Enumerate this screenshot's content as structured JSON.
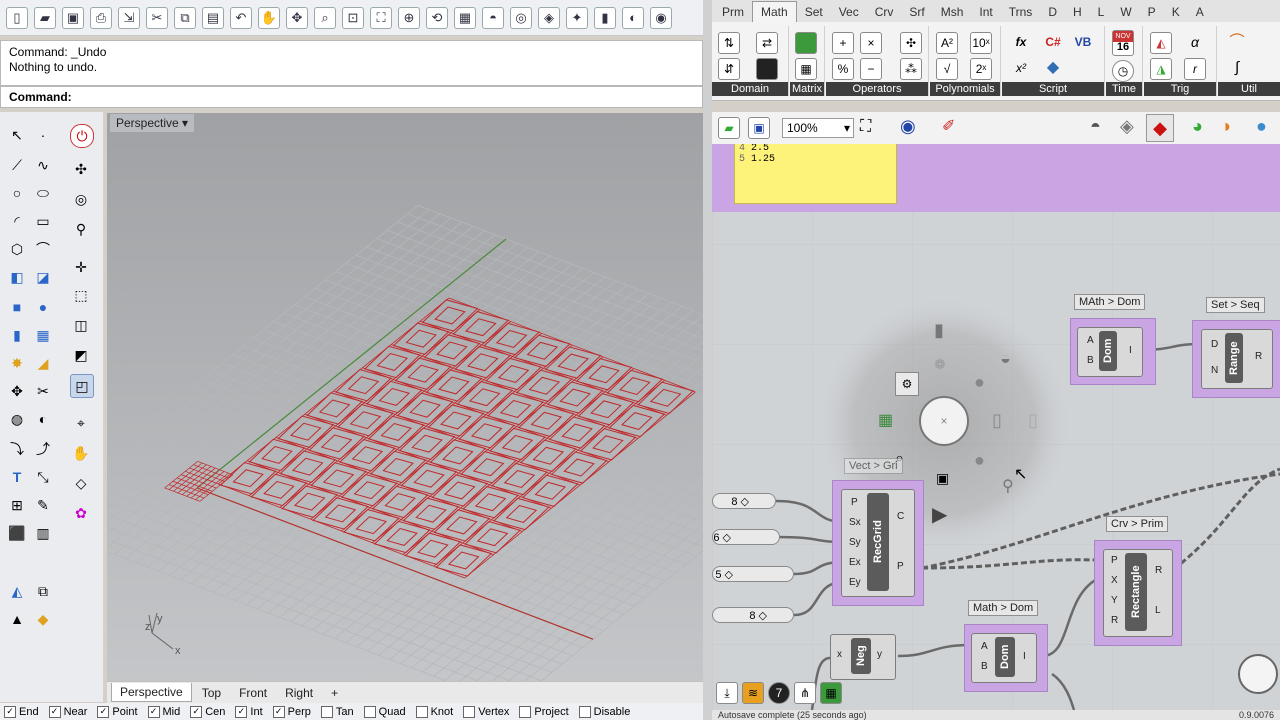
{
  "rhino": {
    "toolbar_icons": [
      "new-icon",
      "open-icon",
      "save-icon",
      "print-icon",
      "import-icon",
      "cut-icon",
      "copy-icon",
      "paste-icon",
      "undo-icon",
      "pan-icon",
      "move-icon",
      "zoom-icon",
      "zoom-window-icon",
      "zoom-extents-icon",
      "zoom-selected-icon",
      "rotate-view-icon",
      "grid-icon",
      "car-icon",
      "select-icon",
      "layer-icon",
      "bulb-icon",
      "lock-icon",
      "color-icon",
      "render-icon"
    ],
    "command_history": [
      "Command: _Undo",
      "Nothing to undo."
    ],
    "command_prompt": "Command:",
    "viewport_label": "Perspective",
    "viewport_axes": {
      "x": "x",
      "y": "y",
      "z": "z"
    },
    "viewport_tabs": [
      "Perspective",
      "Top",
      "Front",
      "Right"
    ],
    "viewport_add_tab": "+",
    "osnaps": [
      {
        "label": "End",
        "checked": true
      },
      {
        "label": "Near",
        "checked": true
      },
      {
        "label": "Point",
        "checked": true
      },
      {
        "label": "Mid",
        "checked": true
      },
      {
        "label": "Cen",
        "checked": true
      },
      {
        "label": "Int",
        "checked": true
      },
      {
        "label": "Perp",
        "checked": true
      },
      {
        "label": "Tan",
        "checked": false
      },
      {
        "label": "Quad",
        "checked": false
      },
      {
        "label": "Knot",
        "checked": false
      },
      {
        "label": "Vertex",
        "checked": false
      },
      {
        "label": "Project",
        "checked": false
      },
      {
        "label": "Disable",
        "checked": false
      }
    ]
  },
  "grasshopper": {
    "tabs": [
      "Prm",
      "Math",
      "Set",
      "Vec",
      "Crv",
      "Srf",
      "Msh",
      "Int",
      "Trns",
      "D",
      "H",
      "L",
      "W",
      "P",
      "K",
      "A"
    ],
    "active_tab": "Math",
    "ribbon_groups": [
      "Domain",
      "Matrix",
      "Operators",
      "Polynomials",
      "Script",
      "Time",
      "Trig",
      "Util"
    ],
    "ribbon_glyphs": [
      "+",
      "×",
      "%",
      "−",
      "A²",
      "√",
      "10ˣ",
      "2ˣ",
      "fx",
      "C#",
      "VB",
      "x²",
      "16",
      "α",
      "r"
    ],
    "calendar": {
      "month": "NOV",
      "day": "16"
    },
    "zoom": "100%",
    "panel_rows": [
      {
        "index": "4",
        "value": "2.5"
      },
      {
        "index": "5",
        "value": "1.25"
      }
    ],
    "components": {
      "dom1": {
        "tag": "MAth > Dom",
        "name": "Dom",
        "inputs": [
          "A",
          "B"
        ],
        "outputs": [
          "I"
        ]
      },
      "range": {
        "tag": "Set > Seq",
        "name": "Range",
        "inputs": [
          "D",
          "N"
        ],
        "outputs": [
          "R"
        ]
      },
      "recgrid": {
        "tag": "Vect > Gri",
        "name": "RecGrid",
        "inputs": [
          "P",
          "Sx",
          "Sy",
          "Ex",
          "Ey"
        ],
        "outputs": [
          "C",
          "P"
        ]
      },
      "rectangle": {
        "tag": "Crv > Prim",
        "name": "Rectangle",
        "inputs": [
          "P",
          "X",
          "Y",
          "R"
        ],
        "outputs": [
          "R",
          "L"
        ]
      },
      "dom2": {
        "tag": "Math > Dom",
        "name": "Dom",
        "inputs": [
          "A",
          "B"
        ],
        "outputs": [
          "I"
        ]
      },
      "neg": {
        "name": "Neg",
        "inputs": [
          "x"
        ],
        "outputs": [
          "y"
        ]
      }
    },
    "sliders": [
      "8",
      "6",
      "5",
      "8"
    ],
    "status": "Autosave complete (25 seconds ago)",
    "version": "0.9.0076"
  }
}
